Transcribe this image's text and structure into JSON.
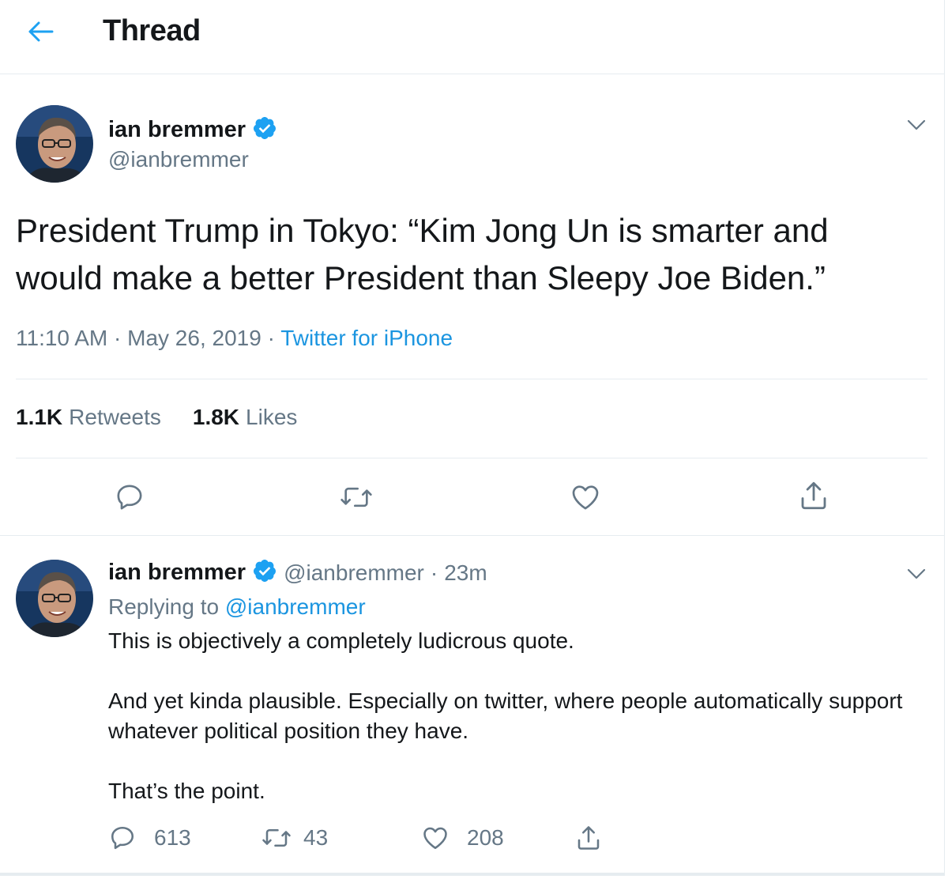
{
  "header": {
    "title": "Thread"
  },
  "main_tweet": {
    "author_name": "ian bremmer",
    "author_handle": "@ianbremmer",
    "text_line1": "President Trump in Tokyo: “Kim Jong Un is smarter and",
    "text_line2": "would make a better President than Sleepy Joe Biden.”",
    "time": "11:10 AM",
    "date": "May 26, 2019",
    "separator": "·",
    "source": "Twitter for iPhone",
    "retweets_count": "1.1K",
    "retweets_label": "Retweets",
    "likes_count": "1.8K",
    "likes_label": "Likes"
  },
  "reply_tweet": {
    "author_name": "ian bremmer",
    "author_handle": "@ianbremmer",
    "separator": "·",
    "time_ago": "23m",
    "replying_to_label": "Replying to",
    "replying_to_handle": "@ianbremmer",
    "paragraphs": [
      "This is objectively a completely ludicrous quote.",
      "And yet kinda plausible. Especially on twitter, where people automatically support whatever political position they have.",
      "That’s the point."
    ],
    "reply_count": "613",
    "retweet_count": "43",
    "like_count": "208"
  },
  "colors": {
    "text": "#14171a",
    "secondary": "#657786",
    "accent": "#1b95e0",
    "verified": "#1da1f2",
    "border": "#e6ecf0"
  },
  "icons": [
    "arrow-left-icon",
    "verified-badge-icon",
    "chevron-down-icon",
    "reply-icon",
    "retweet-icon",
    "like-icon",
    "share-icon"
  ]
}
